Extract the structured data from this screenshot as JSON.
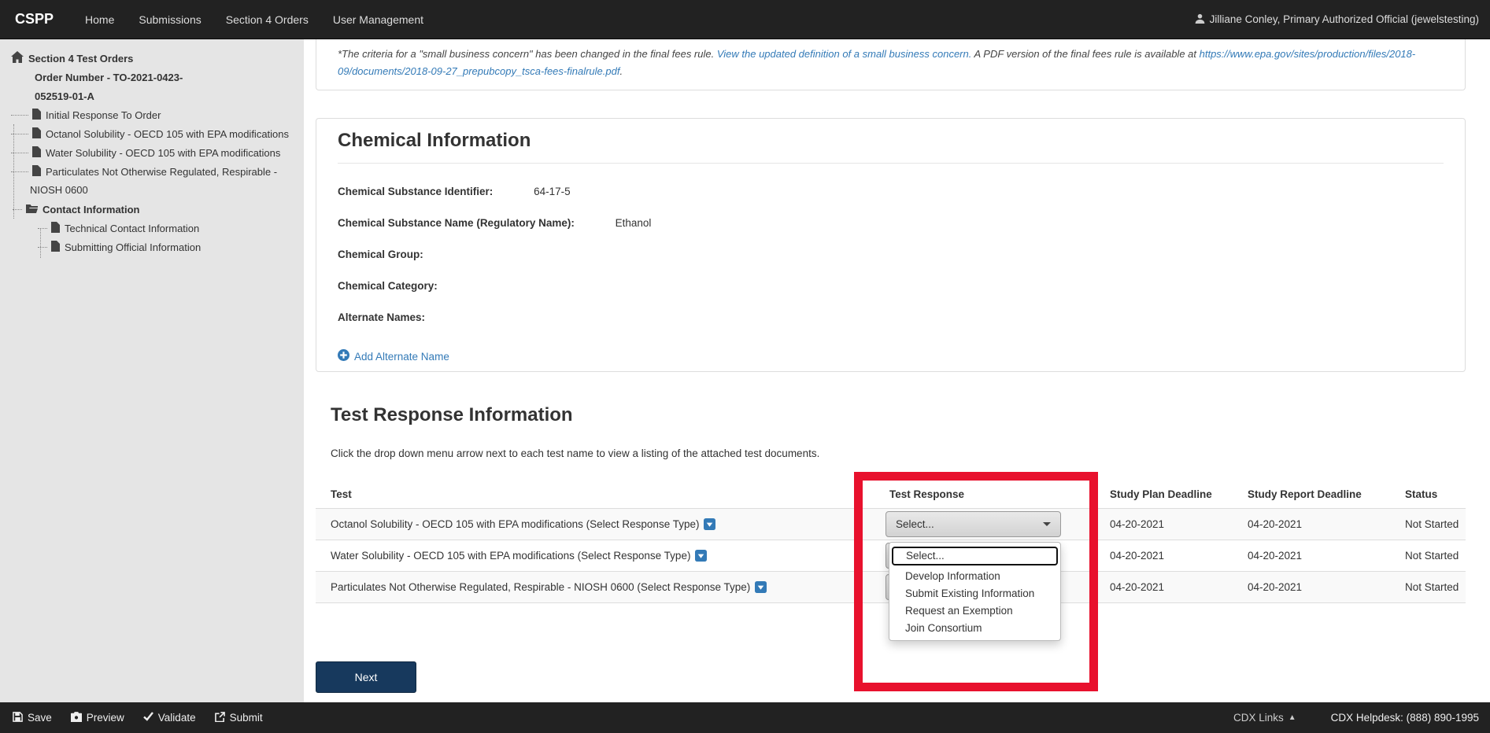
{
  "navbar": {
    "brand": "CSPP",
    "items": [
      "Home",
      "Submissions",
      "Section 4 Orders",
      "User Management"
    ],
    "user": "Jilliane Conley, Primary Authorized Official (jewelstesting)"
  },
  "sidebar": {
    "root_label": "Section 4 Test Orders",
    "order_number": {
      "line1": "Order Number - TO-2021-0423-",
      "line2": "052519-01-A"
    },
    "documents": [
      {
        "label": "Initial Response To Order"
      },
      {
        "label": "Octanol Solubility - OECD 105 with EPA modifications"
      },
      {
        "label": "Water Solubility - OECD 105 with EPA modifications"
      },
      {
        "label": "Particulates Not Otherwise Regulated, Respirable -",
        "label_line2": "NIOSH 0600"
      }
    ],
    "contact": {
      "label": "Contact Information",
      "children": [
        "Technical Contact Information",
        "Submitting Official Information"
      ]
    }
  },
  "notice": {
    "text_1": "*The criteria for a \"small business concern\" has been changed in the final fees rule. ",
    "link_definition": "View the updated definition of a small business concern.",
    "text_2": " A PDF version of the final fees rule is available at ",
    "link_url": "https://www.epa.gov/sites/production/files/2018-09/documents/2018-09-27_prepubcopy_tsca-fees-finalrule.pdf",
    "text_3": "."
  },
  "chemical": {
    "title": "Chemical Information",
    "fields": [
      {
        "label": "Chemical Substance Identifier:",
        "value": "64-17-5"
      },
      {
        "label": "Chemical Substance Name (Regulatory Name):",
        "value": "Ethanol"
      },
      {
        "label": "Chemical Group:",
        "value": ""
      },
      {
        "label": "Chemical Category:",
        "value": ""
      },
      {
        "label": "Alternate Names:",
        "value": ""
      }
    ],
    "add_label": "Add Alternate Name"
  },
  "test_response": {
    "title": "Test Response Information",
    "description": "Click the drop down menu arrow next to each test name to view a listing of the attached test documents.",
    "columns": [
      "Test",
      "Test Response",
      "Study Plan Deadline",
      "Study Report Deadline",
      "Status"
    ],
    "rows": [
      {
        "test": "Octanol Solubility - OECD 105 with EPA modifications (Select Response Type)",
        "response": "Select...",
        "study_plan": "04-20-2021",
        "study_report": "04-20-2021",
        "status": "Not Started"
      },
      {
        "test": "Water Solubility - OECD 105 with EPA modifications (Select Response Type)",
        "response": "Select...",
        "study_plan": "04-20-2021",
        "study_report": "04-20-2021",
        "status": "Not Started"
      },
      {
        "test": "Particulates Not Otherwise Regulated, Respirable - NIOSH 0600 (Select Response Type)",
        "response": "Select...",
        "study_plan": "04-20-2021",
        "study_report": "04-20-2021",
        "status": "Not Started"
      }
    ],
    "dropdown_options": [
      "Select...",
      "Develop Information",
      "Submit Existing Information",
      "Request an Exemption",
      "Join Consortium"
    ]
  },
  "buttons": {
    "next": "Next"
  },
  "footer": {
    "actions": [
      "Save",
      "Preview",
      "Validate",
      "Submit"
    ],
    "cdx_links": "CDX Links",
    "cdx_caret": "▲",
    "helpdesk": "CDX Helpdesk: (888) 890-1995"
  },
  "colors": {
    "navbar_bg": "#222222",
    "sidebar_bg": "#e5e5e5",
    "link_blue": "#337ab7",
    "highlight_red": "#e8112d",
    "next_button_navy": "#17395d",
    "row_stripe": "#f9f9f9"
  }
}
